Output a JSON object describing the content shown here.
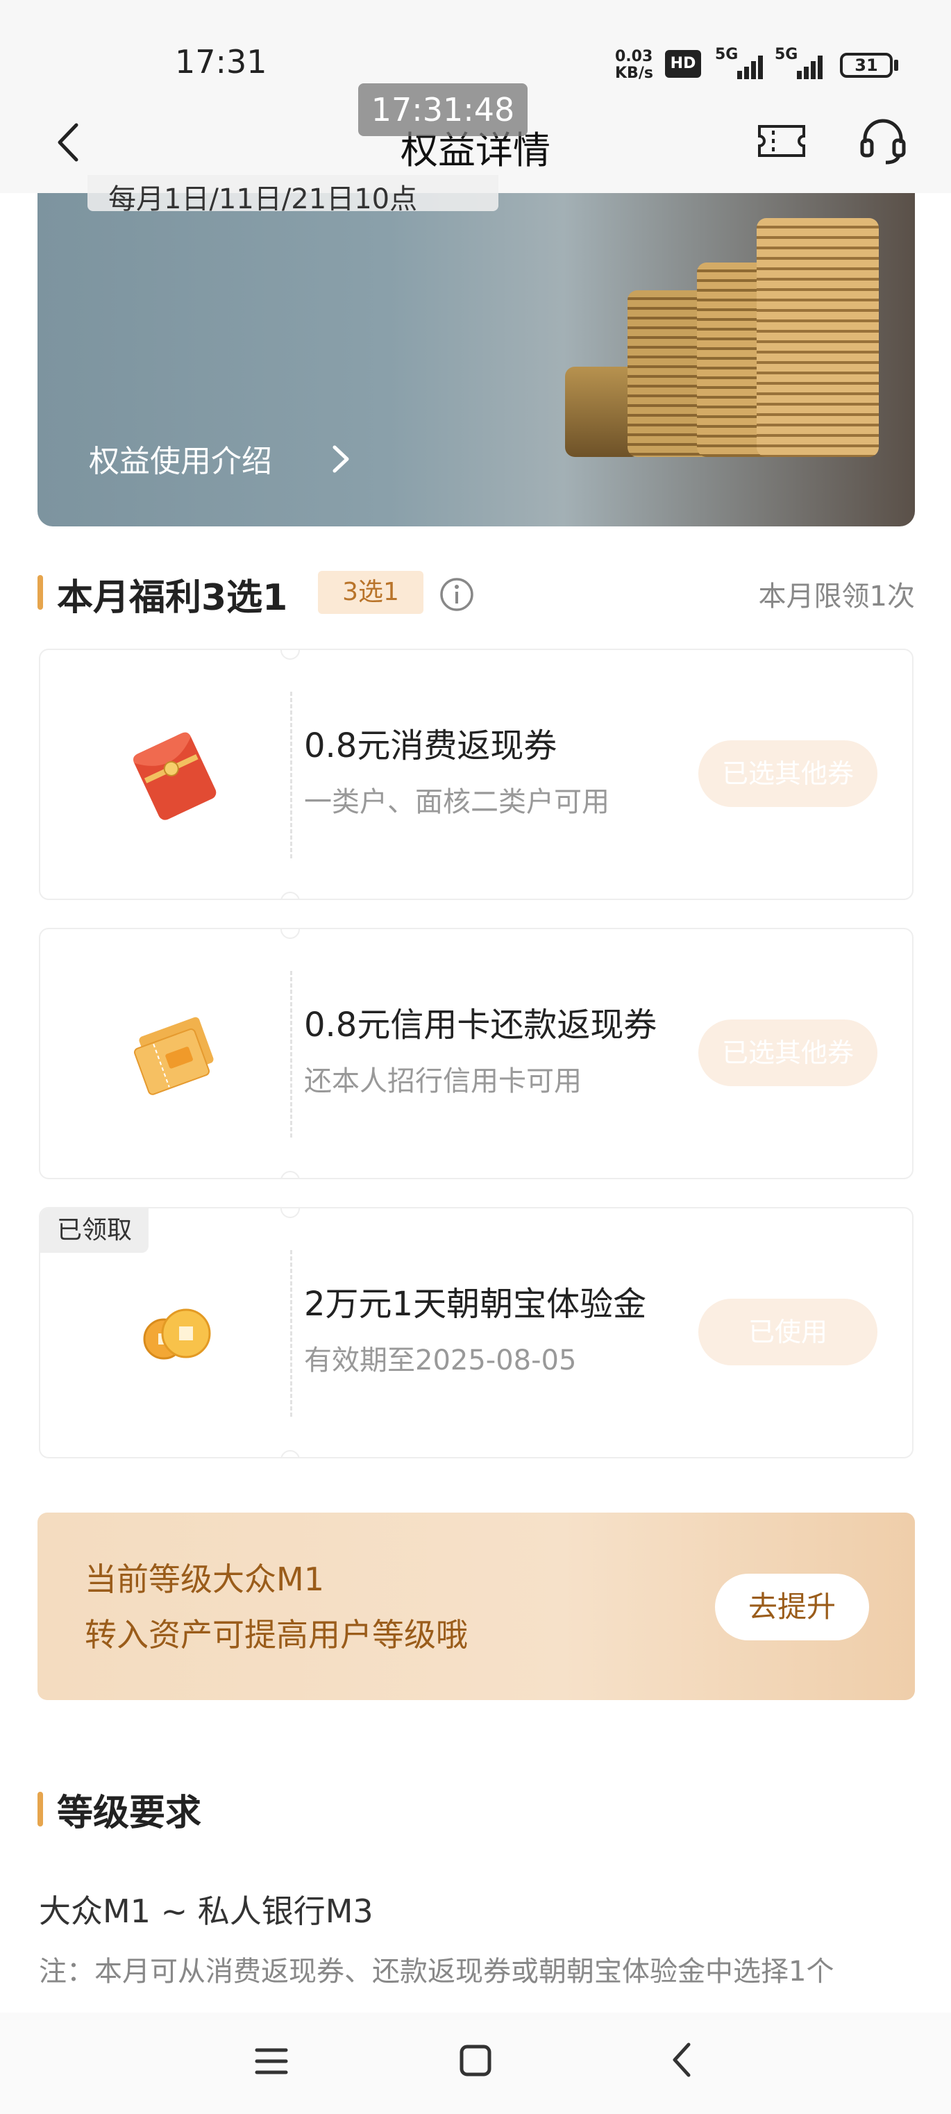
{
  "status_bar": {
    "time": "17:31",
    "net_speed_value": "0.03",
    "net_speed_unit": "KB/s",
    "hd_label": "HD",
    "signal_1": "5G",
    "signal_2": "5G",
    "battery": "31"
  },
  "header": {
    "title": "权益详情",
    "overlay_time": "17:31:48",
    "icons": [
      "back-arrow-icon",
      "ticket-icon",
      "headset-icon"
    ]
  },
  "banner": {
    "date_text": "每月1日/11日/21日10点",
    "intro_link": "权益使用介绍"
  },
  "monthly": {
    "title": "本月福利3选1",
    "badge": "3选1",
    "limit": "本月限领1次"
  },
  "coupons": [
    {
      "icon": "red-envelope-icon",
      "title": "0.8元消费返现券",
      "subtitle": "一类户、面核二类户可用",
      "button": "已选其他券",
      "tag": ""
    },
    {
      "icon": "ticket-coupon-icon",
      "title": "0.8元信用卡还款返现券",
      "subtitle": "还本人招行信用卡可用",
      "button": "已选其他券",
      "tag": ""
    },
    {
      "icon": "gold-coin-icon",
      "title": "2万元1天朝朝宝体验金",
      "subtitle": "有效期至2025-08-05",
      "button": "已使用",
      "tag": "已领取"
    }
  ],
  "level": {
    "line1": "当前等级大众M1",
    "line2": "转入资产可提高用户等级哦",
    "button": "去提升"
  },
  "requirements": {
    "title": "等级要求",
    "range": "大众M1 ~ 私人银行M3",
    "note": "注：本月可从消费返现券、还款返现券或朝朝宝体验金中选择1个"
  },
  "colors": {
    "accent": "#e6a54d",
    "level_text": "#9a5c1a",
    "disabled_button": "#fbeee2"
  }
}
